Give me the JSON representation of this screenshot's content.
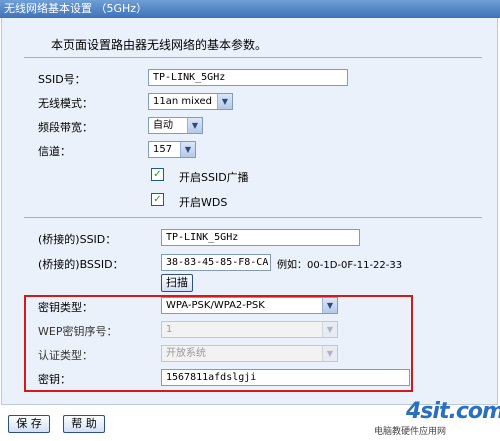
{
  "window": {
    "title": "无线网络基本设置 （5GHz）"
  },
  "description": "本页面设置路由器无线网络的基本参数。",
  "fields": {
    "ssid": {
      "label": "SSID号：",
      "value": "TP-LINK_5GHz"
    },
    "mode": {
      "label": "无线模式：",
      "value": "11an mixed"
    },
    "bandwidth": {
      "label": "频段带宽：",
      "value": "自动"
    },
    "channel": {
      "label": "信道：",
      "value": "157"
    }
  },
  "checkboxes": {
    "ssid_broadcast": {
      "label": "开启SSID广播",
      "checked": true
    },
    "wds": {
      "label": "开启WDS",
      "checked": true
    }
  },
  "bridge": {
    "ssid_label": "(桥接的)SSID：",
    "ssid_value": "TP-LINK_5GHz",
    "bssid_label": "(桥接的)BSSID：",
    "bssid_value": "38-83-45-85-F8-CA",
    "example": "例如：00-1D-0F-11-22-33",
    "scan_button": "扫描"
  },
  "security": {
    "key_type_label": "密钥类型：",
    "key_type_value": "WPA-PSK/WPA2-PSK",
    "wep_index_label": "WEP密钥序号：",
    "wep_index_value": "1",
    "auth_type_label": "认证类型：",
    "auth_type_value": "开放系统",
    "key_label": "密钥：",
    "key_value": "1567811afdslgji"
  },
  "footer": {
    "save_button": "保 存",
    "help_button": "帮 助"
  },
  "watermark": {
    "brand": "4sit.com",
    "subtitle": "电脑教硬件应用网"
  },
  "colors": {
    "accent": "#3f72b8",
    "panel": "#eaf1fb",
    "highlight": "#d11a1a"
  }
}
